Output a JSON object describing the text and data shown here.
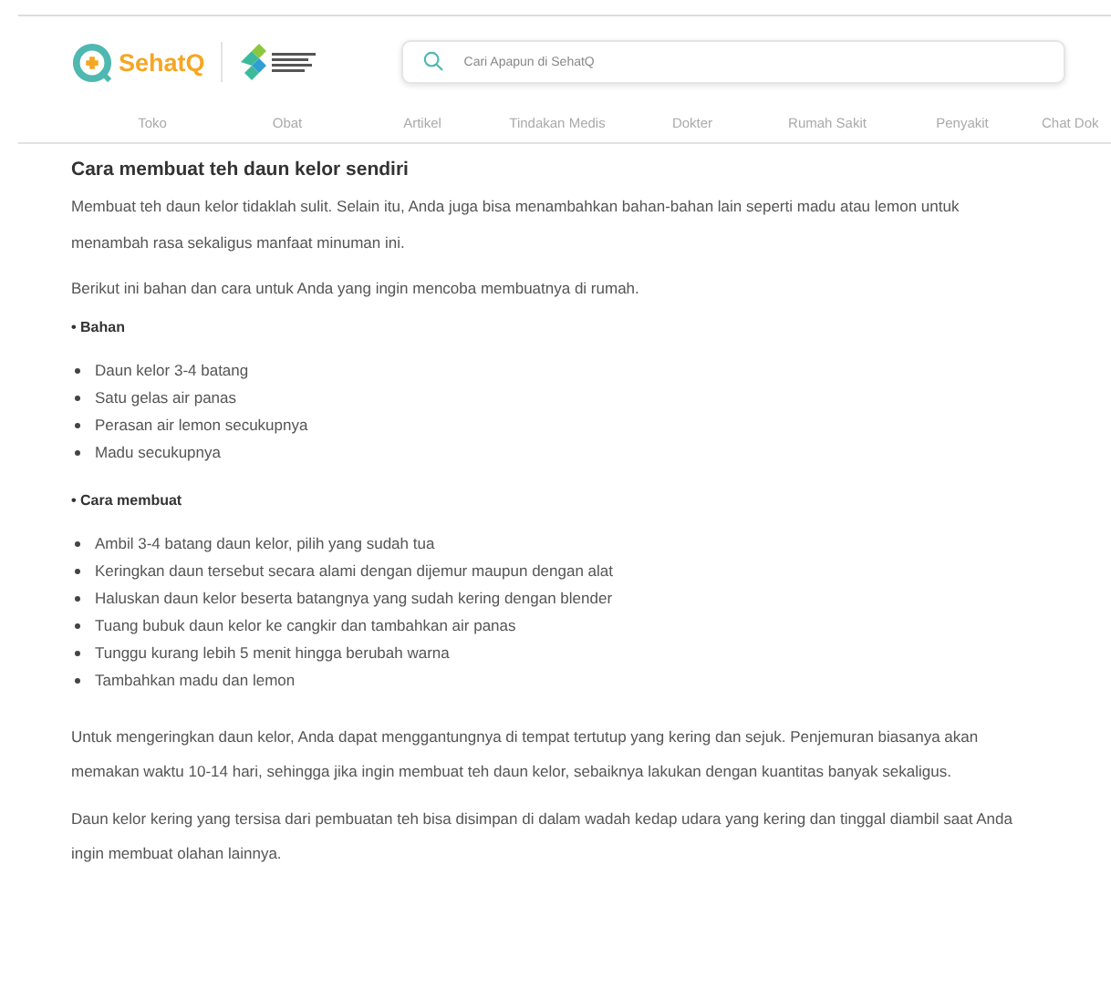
{
  "header": {
    "brand": "SehatQ",
    "search": {
      "placeholder": "Cari Apapun di SehatQ"
    }
  },
  "nav": [
    "Toko",
    "Obat",
    "Artikel",
    "Tindakan Medis",
    "Dokter",
    "Rumah Sakit",
    "Penyakit",
    "Chat Dok"
  ],
  "article": {
    "title": "Cara membuat teh daun kelor sendiri",
    "blocks": [
      {
        "kind": "paragraph",
        "text": "Membuat teh daun kelor tidaklah sulit. Selain itu, Anda juga bisa menambahkan bahan-bahan lain seperti madu atau lemon untuk menambah rasa sekaligus manfaat minuman ini."
      },
      {
        "kind": "paragraph",
        "text": "Berikut ini bahan dan cara untuk Anda yang ingin mencoba membuatnya di rumah."
      },
      {
        "kind": "heading",
        "text": "• Bahan"
      },
      {
        "kind": "list",
        "items": [
          "Daun kelor 3-4 batang",
          "Satu gelas air panas",
          "Perasan air lemon secukupnya",
          "Madu secukupnya"
        ]
      },
      {
        "kind": "heading",
        "text": "• Cara membuat"
      },
      {
        "kind": "list",
        "items": [
          "Ambil 3-4 batang daun kelor, pilih yang sudah tua",
          "Keringkan daun tersebut secara alami dengan dijemur maupun dengan alat",
          "Haluskan daun kelor beserta batangnya yang sudah kering dengan blender",
          "Tuang bubuk daun kelor ke cangkir dan tambahkan air panas",
          "Tunggu kurang lebih 5 menit hingga berubah warna",
          "Tambahkan madu dan lemon"
        ]
      },
      {
        "kind": "paragraph",
        "text": "Untuk mengeringkan daun kelor, Anda dapat menggantungnya di tempat tertutup yang kering dan sejuk. Penjemuran biasanya akan memakan waktu 10-14 hari, sehingga jika ingin membuat teh daun kelor, sebaiknya lakukan dengan kuantitas banyak sekaligus."
      },
      {
        "kind": "paragraph",
        "text": "Daun kelor kering yang tersisa dari pembuatan teh bisa disimpan di dalam wadah kedap udara yang kering dan tinggal diambil saat Anda ingin membuat olahan lainnya."
      }
    ]
  }
}
